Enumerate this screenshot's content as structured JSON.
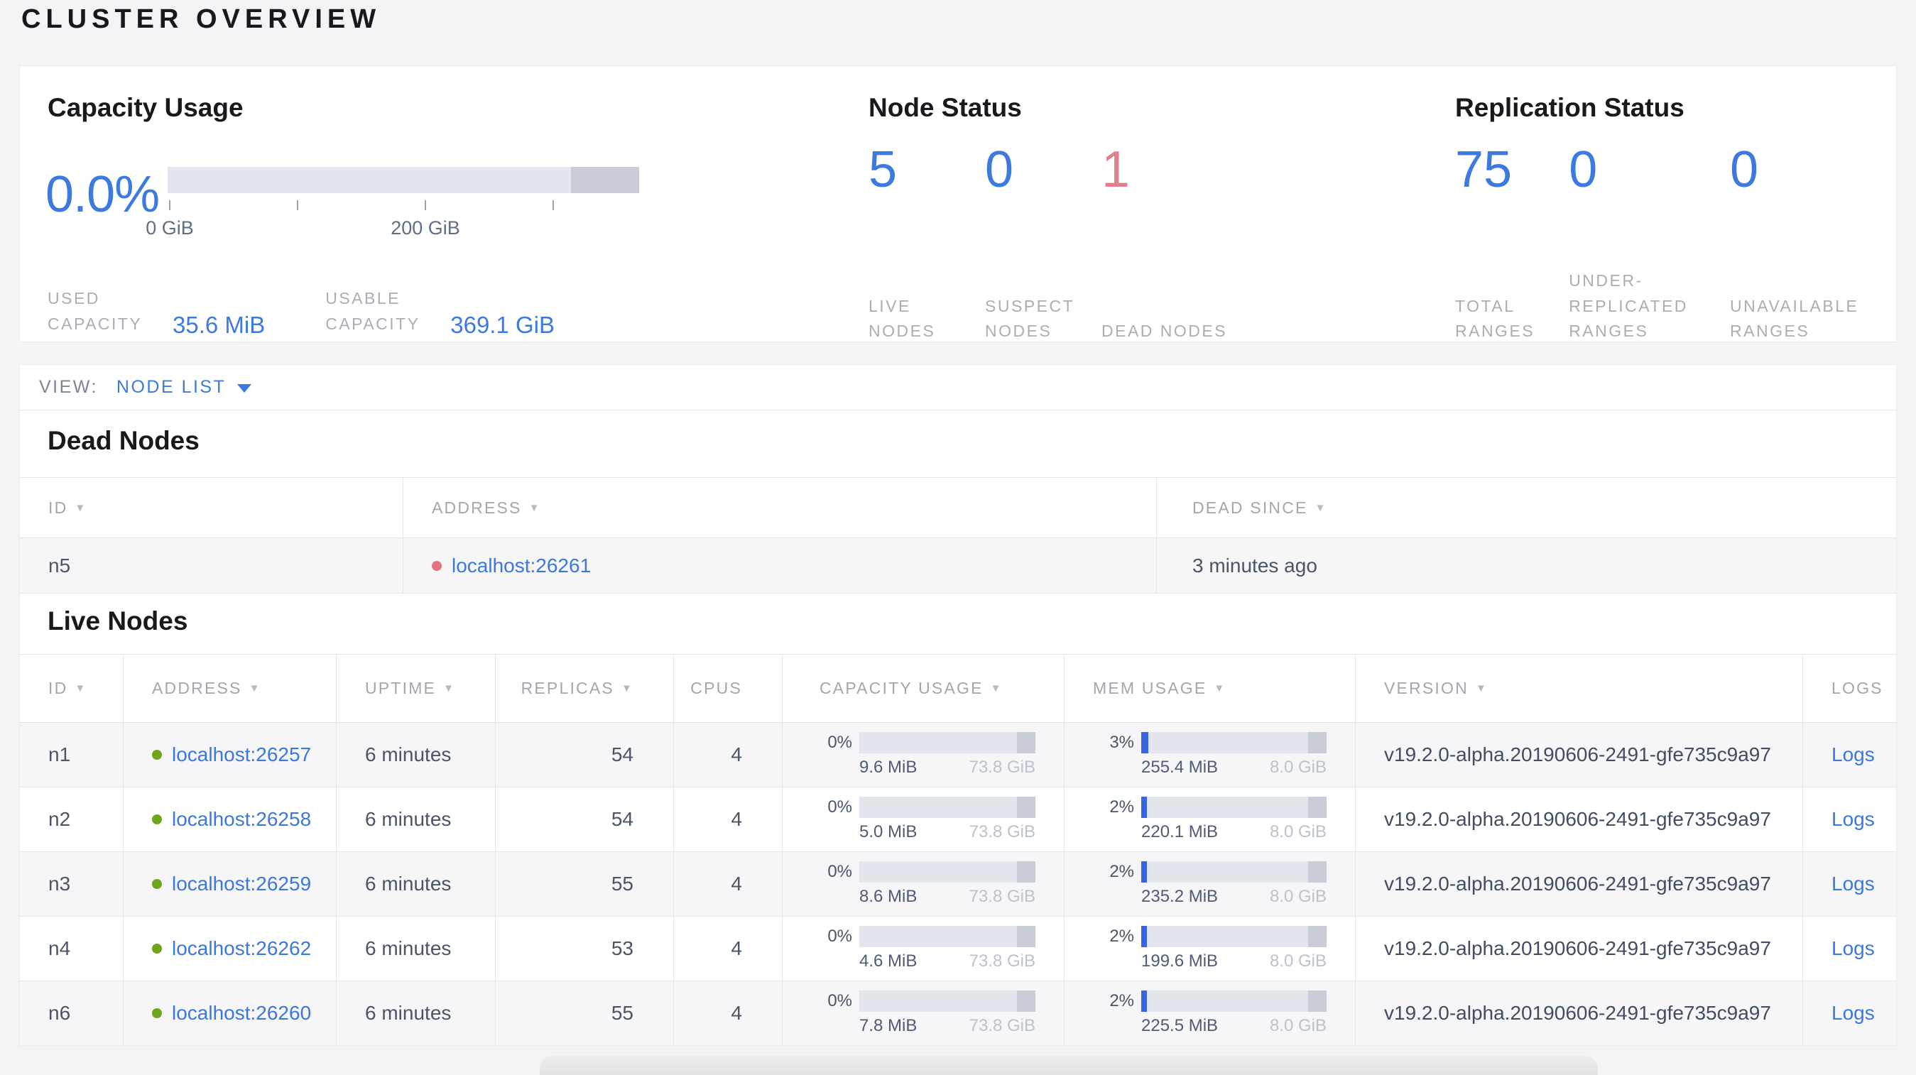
{
  "page": {
    "title": "CLUSTER OVERVIEW"
  },
  "colors": {
    "blue": "#3d7ae0",
    "red": "#e0808c",
    "green": "#6fa41f",
    "dot-red": "#e0737d"
  },
  "summary": {
    "capacity": {
      "title": "Capacity Usage",
      "percent": "0.0%",
      "tick_labels": [
        "0 GiB",
        "200 GiB"
      ],
      "used_label": "USED CAPACITY",
      "used_value": "35.6 MiB",
      "usable_label": "USABLE CAPACITY",
      "usable_value": "369.1 GiB"
    },
    "node_status": {
      "title": "Node Status",
      "items": [
        {
          "value": "5",
          "label": "LIVE NODES"
        },
        {
          "value": "0",
          "label": "SUSPECT NODES"
        },
        {
          "value": "1",
          "label": "DEAD NODES"
        }
      ]
    },
    "replication": {
      "title": "Replication Status",
      "items": [
        {
          "value": "75",
          "label": "TOTAL RANGES"
        },
        {
          "value": "0",
          "label": "UNDER-REPLICATED RANGES"
        },
        {
          "value": "0",
          "label": "UNAVAILABLE RANGES"
        }
      ]
    }
  },
  "view_bar": {
    "label": "VIEW:",
    "selected": "NODE LIST"
  },
  "dead_nodes": {
    "title": "Dead Nodes",
    "columns": [
      {
        "label": "ID"
      },
      {
        "label": "ADDRESS"
      },
      {
        "label": "DEAD SINCE"
      }
    ],
    "rows": [
      {
        "id": "n5",
        "address": "localhost:26261",
        "dead_since": "3 minutes ago"
      }
    ]
  },
  "live_nodes": {
    "title": "Live Nodes",
    "logs_link_label": "Logs",
    "columns": [
      {
        "label": "ID"
      },
      {
        "label": "ADDRESS"
      },
      {
        "label": "UPTIME"
      },
      {
        "label": "REPLICAS"
      },
      {
        "label": "CPUS"
      },
      {
        "label": "CAPACITY USAGE"
      },
      {
        "label": "MEM USAGE"
      },
      {
        "label": "VERSION"
      },
      {
        "label": "LOGS"
      }
    ],
    "rows": [
      {
        "id": "n1",
        "address": "localhost:26257",
        "uptime": "6 minutes",
        "replicas": "54",
        "cpus": "4",
        "capacity_pct": "0%",
        "capacity_used": "9.6 MiB",
        "capacity_total": "73.8 GiB",
        "mem_pct": "3%",
        "mem_used": "255.4 MiB",
        "mem_total": "8.0 GiB",
        "version": "v19.2.0-alpha.20190606-2491-gfe735c9a97"
      },
      {
        "id": "n2",
        "address": "localhost:26258",
        "uptime": "6 minutes",
        "replicas": "54",
        "cpus": "4",
        "capacity_pct": "0%",
        "capacity_used": "5.0 MiB",
        "capacity_total": "73.8 GiB",
        "mem_pct": "2%",
        "mem_used": "220.1 MiB",
        "mem_total": "8.0 GiB",
        "version": "v19.2.0-alpha.20190606-2491-gfe735c9a97"
      },
      {
        "id": "n3",
        "address": "localhost:26259",
        "uptime": "6 minutes",
        "replicas": "55",
        "cpus": "4",
        "capacity_pct": "0%",
        "capacity_used": "8.6 MiB",
        "capacity_total": "73.8 GiB",
        "mem_pct": "2%",
        "mem_used": "235.2 MiB",
        "mem_total": "8.0 GiB",
        "version": "v19.2.0-alpha.20190606-2491-gfe735c9a97"
      },
      {
        "id": "n4",
        "address": "localhost:26262",
        "uptime": "6 minutes",
        "replicas": "53",
        "cpus": "4",
        "capacity_pct": "0%",
        "capacity_used": "4.6 MiB",
        "capacity_total": "73.8 GiB",
        "mem_pct": "2%",
        "mem_used": "199.6 MiB",
        "mem_total": "8.0 GiB",
        "version": "v19.2.0-alpha.20190606-2491-gfe735c9a97"
      },
      {
        "id": "n6",
        "address": "localhost:26260",
        "uptime": "6 minutes",
        "replicas": "55",
        "cpus": "4",
        "capacity_pct": "0%",
        "capacity_used": "7.8 MiB",
        "capacity_total": "73.8 GiB",
        "mem_pct": "2%",
        "mem_used": "225.5 MiB",
        "mem_total": "8.0 GiB",
        "version": "v19.2.0-alpha.20190606-2491-gfe735c9a97"
      }
    ]
  }
}
